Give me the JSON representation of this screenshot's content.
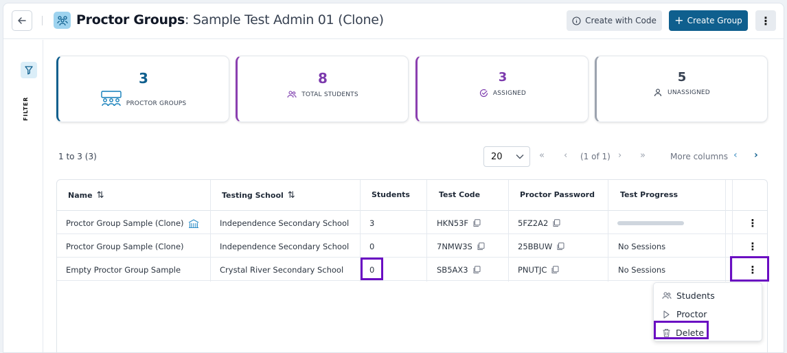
{
  "header": {
    "title_bold": "Proctor Groups",
    "title_rest": ": Sample Test Admin 01 (Clone)",
    "create_with_code": "Create with Code",
    "create_group": "Create Group"
  },
  "rail": {
    "filter_label": "FILTER"
  },
  "stats": [
    {
      "value": "3",
      "label": "PROCTOR GROUPS",
      "icon": "group-icon"
    },
    {
      "value": "8",
      "label": "TOTAL STUDENTS",
      "icon": "users-icon"
    },
    {
      "value": "3",
      "label": "ASSIGNED",
      "icon": "check-circle-icon"
    },
    {
      "value": "5",
      "label": "UNASSIGNED",
      "icon": "user-icon"
    }
  ],
  "pager": {
    "range": "1 to 3 (3)",
    "page_size": "20",
    "page_info": "(1 of 1)",
    "more_columns": "More columns"
  },
  "table": {
    "columns": [
      "Name",
      "Testing School",
      "Students",
      "Test Code",
      "Proctor Password",
      "Test Progress"
    ],
    "rows": [
      {
        "name": "Proctor Group Sample (Clone)",
        "school": "Independence Secondary School",
        "students": "3",
        "code": "HKN53F",
        "password": "5FZ2A2",
        "progress": ""
      },
      {
        "name": "Proctor Group Sample (Clone)",
        "school": "Independence Secondary School",
        "students": "0",
        "code": "7NMW3S",
        "password": "25BBUW",
        "progress": "No Sessions"
      },
      {
        "name": "Empty Proctor Group Sample",
        "school": "Crystal River Secondary School",
        "students": "0",
        "code": "SB5AX3",
        "password": "PNUTJC",
        "progress": "No Sessions"
      }
    ]
  },
  "menu": {
    "items": [
      "Students",
      "Proctor",
      "Delete"
    ]
  },
  "colors": {
    "primary": "#0f5f8e",
    "purple": "#7c3aad",
    "highlight": "#6a0dc2"
  }
}
